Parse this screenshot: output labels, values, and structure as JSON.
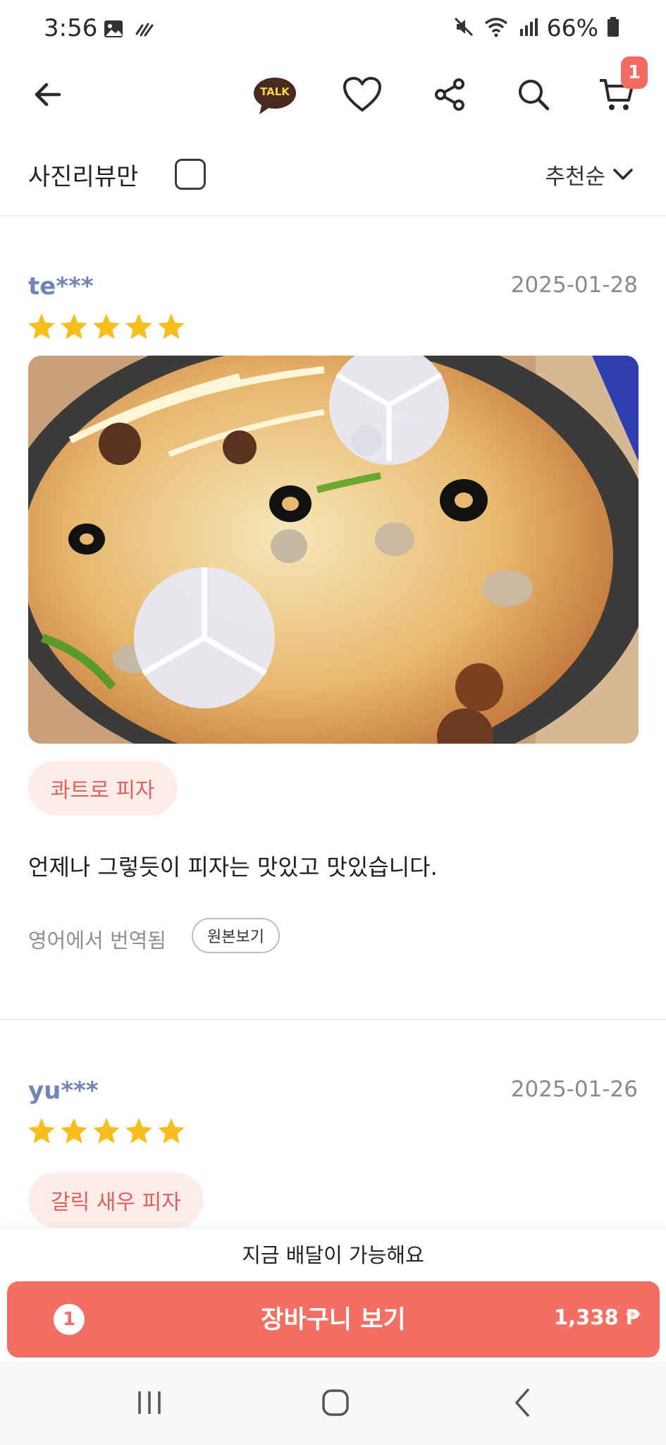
{
  "status_bar": {
    "time": "3:56",
    "battery": "66%",
    "icons": [
      "gallery-icon",
      "vpn-icon",
      "mute-icon",
      "wifi-icon",
      "signal-icon",
      "battery-icon"
    ]
  },
  "top_nav": {
    "back_icon": "arrow-left-icon",
    "talk_label": "TALK",
    "cart_badge": "1",
    "icons": [
      "kakaotalk-icon",
      "heart-icon",
      "share-icon",
      "search-icon",
      "cart-icon"
    ]
  },
  "filter": {
    "photo_only_label": "사진리뷰만",
    "sort_label": "추천순"
  },
  "reviews": [
    {
      "user": "te***",
      "date": "2025-01-28",
      "rating": 5,
      "menu": "콰트로 피자",
      "text": "언제나 그렇듯이 피자는 맛있고 맛있습니다.",
      "translated": "영어에서 번역됨",
      "original_button": "원본보기"
    },
    {
      "user": "yu***",
      "date": "2025-01-26",
      "rating": 5,
      "menu": "갈릭 새우 피자"
    }
  ],
  "bottom": {
    "delivery_notice": "지금 배달이 가능해요",
    "cart_count": "1",
    "cart_button": "장바구니 보기",
    "price": "1,338 ₱"
  },
  "colors": {
    "accent": "#f46f63",
    "chip_bg": "#fdecea",
    "star": "#f5be1c",
    "username": "#6f86b4"
  }
}
